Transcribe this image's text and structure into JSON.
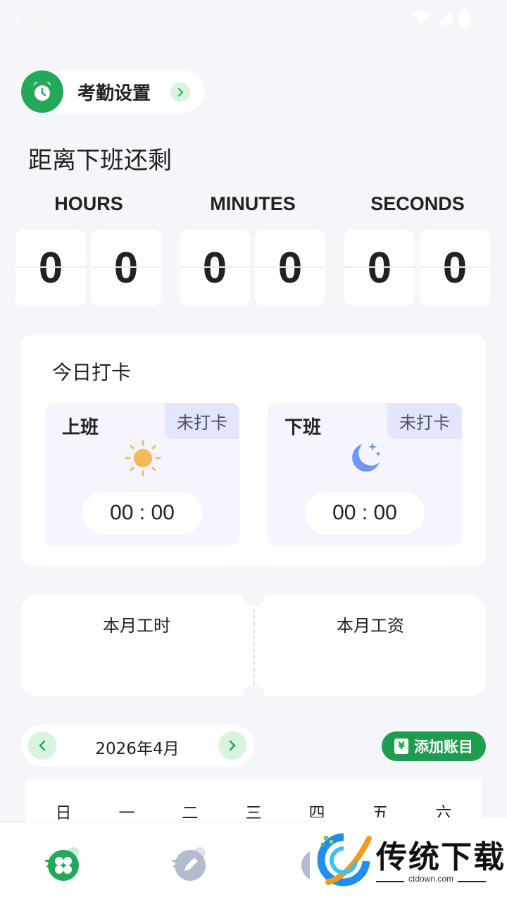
{
  "status_bar": {
    "time": "1:08"
  },
  "settings": {
    "label": "考勤设置"
  },
  "countdown": {
    "title": "距离下班还剩",
    "units": [
      {
        "label": "HOURS",
        "digits": [
          "0",
          "0"
        ]
      },
      {
        "label": "MINUTES",
        "digits": [
          "0",
          "0"
        ]
      },
      {
        "label": "SECONDS",
        "digits": [
          "0",
          "0"
        ]
      }
    ]
  },
  "today": {
    "title": "今日打卡",
    "clock_in": {
      "label": "上班",
      "status": "未打卡",
      "time": "00 : 00"
    },
    "clock_out": {
      "label": "下班",
      "status": "未打卡",
      "time": "00 : 00"
    }
  },
  "month_stats": {
    "hours_label": "本月工时",
    "salary_label": "本月工资"
  },
  "calendar": {
    "month": "2026年4月",
    "add_button": "添加账目",
    "ledger_glyph": "¥",
    "weekdays": [
      "日",
      "一",
      "二",
      "三",
      "四",
      "五",
      "六"
    ]
  },
  "watermark": {
    "title": "传统下载",
    "subtitle": "ctdown.com"
  },
  "colors": {
    "accent": "#22a95a",
    "light_accent": "#d8f3de",
    "background": "#f5f6f9"
  }
}
